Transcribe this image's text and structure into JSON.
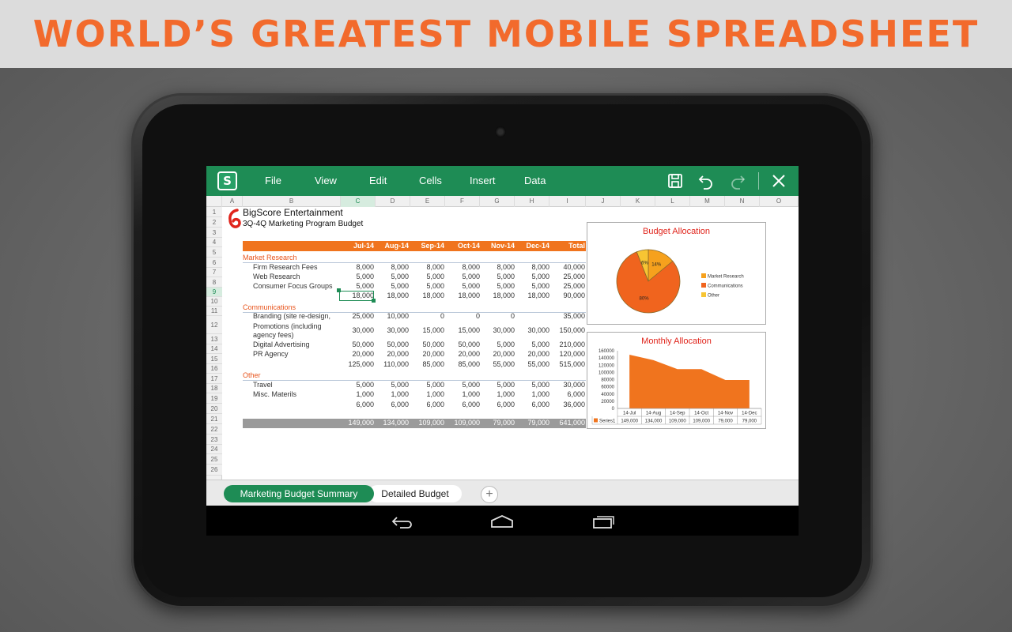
{
  "banner": {
    "title": "WORLD’S GREATEST MOBILE SPREADSHEET"
  },
  "toolbar": {
    "logo": "S",
    "menu": [
      "File",
      "View",
      "Edit",
      "Cells",
      "Insert",
      "Data"
    ],
    "icons": [
      "save-icon",
      "undo-icon",
      "redo-icon",
      "close-icon"
    ]
  },
  "grid": {
    "columns": [
      "A",
      "B",
      "C",
      "D",
      "E",
      "F",
      "G",
      "H",
      "I",
      "J",
      "K",
      "L",
      "M",
      "N",
      "O"
    ],
    "selected_column": "C",
    "rows": [
      "1",
      "2",
      "3",
      "4",
      "5",
      "6",
      "7",
      "8",
      "9",
      "10",
      "11",
      "12",
      "13",
      "14",
      "15",
      "16",
      "17",
      "18",
      "19",
      "20",
      "21",
      "22",
      "23",
      "24",
      "25",
      "26"
    ],
    "selected_row": "9"
  },
  "sheet": {
    "company": "BigScore Entertainment",
    "subtitle": "3Q-4Q Marketing Program Budget",
    "headers": [
      "Jul-14",
      "Aug-14",
      "Sep-14",
      "Oct-14",
      "Nov-14",
      "Dec-14",
      "Total"
    ],
    "sections": {
      "market_research": "Market Research",
      "communications": "Communications",
      "other": "Other"
    },
    "rows": [
      {
        "label": "Firm Research Fees",
        "values": [
          "8,000",
          "8,000",
          "8,000",
          "8,000",
          "8,000",
          "8,000",
          "40,000"
        ]
      },
      {
        "label": "Web Research",
        "values": [
          "5,000",
          "5,000",
          "5,000",
          "5,000",
          "5,000",
          "5,000",
          "25,000"
        ]
      },
      {
        "label": "Consumer Focus Groups",
        "values": [
          "5,000",
          "5,000",
          "5,000",
          "5,000",
          "5,000",
          "5,000",
          "25,000"
        ]
      },
      {
        "label": "",
        "values": [
          "18,000",
          "18,000",
          "18,000",
          "18,000",
          "18,000",
          "18,000",
          "90,000"
        ]
      },
      {
        "label": "Branding (site re-design,",
        "values": [
          "25,000",
          "10,000",
          "0",
          "0",
          "0",
          "",
          "35,000"
        ]
      },
      {
        "label": "Promotions (including agency fees)",
        "values": [
          "30,000",
          "30,000",
          "15,000",
          "15,000",
          "30,000",
          "30,000",
          "150,000"
        ]
      },
      {
        "label": "Digital Advertising",
        "values": [
          "50,000",
          "50,000",
          "50,000",
          "50,000",
          "5,000",
          "5,000",
          "210,000"
        ]
      },
      {
        "label": "PR Agency",
        "values": [
          "20,000",
          "20,000",
          "20,000",
          "20,000",
          "20,000",
          "20,000",
          "120,000"
        ]
      },
      {
        "label": "",
        "values": [
          "125,000",
          "110,000",
          "85,000",
          "85,000",
          "55,000",
          "55,000",
          "515,000"
        ]
      },
      {
        "label": "Travel",
        "values": [
          "5,000",
          "5,000",
          "5,000",
          "5,000",
          "5,000",
          "5,000",
          "30,000"
        ]
      },
      {
        "label": "Misc. Materils",
        "values": [
          "1,000",
          "1,000",
          "1,000",
          "1,000",
          "1,000",
          "1,000",
          "6,000"
        ]
      },
      {
        "label": "",
        "values": [
          "6,000",
          "6,000",
          "6,000",
          "6,000",
          "6,000",
          "6,000",
          "36,000"
        ]
      }
    ],
    "totals": [
      "149,000",
      "134,000",
      "109,000",
      "109,000",
      "79,000",
      "79,000",
      "641,000"
    ]
  },
  "chart_data": [
    {
      "type": "pie",
      "title": "Budget Allocation",
      "categories": [
        "Market Research",
        "Communications",
        "Other"
      ],
      "values": [
        14,
        80,
        6
      ],
      "data_labels": [
        "14%",
        "80%",
        "6%"
      ],
      "colors": [
        "#f6a11d",
        "#f0641e",
        "#f7c533"
      ],
      "legend": "right"
    },
    {
      "type": "area",
      "title": "Monthly Allocation",
      "categories": [
        "14-Jul",
        "14-Aug",
        "14-Sep",
        "14-Oct",
        "14-Nov",
        "14-Dec"
      ],
      "series": [
        {
          "name": "Series1",
          "values": [
            149000,
            134000,
            109000,
            109000,
            79000,
            79000
          ]
        }
      ],
      "table_values": [
        "149,000",
        "134,000",
        "109,000",
        "109,000",
        "79,000",
        "79,000"
      ],
      "y_ticks": [
        "160000",
        "140000",
        "120000",
        "100000",
        "80000",
        "60000",
        "40000",
        "20000",
        "0"
      ],
      "ylim": [
        0,
        160000
      ],
      "color": "#f0741e"
    }
  ],
  "sheet_tabs": {
    "active": "Marketing Budget Summary",
    "inactive": "Detailed Budget",
    "add": "+"
  },
  "system_nav": [
    "back-icon",
    "home-icon",
    "recent-apps-icon"
  ]
}
